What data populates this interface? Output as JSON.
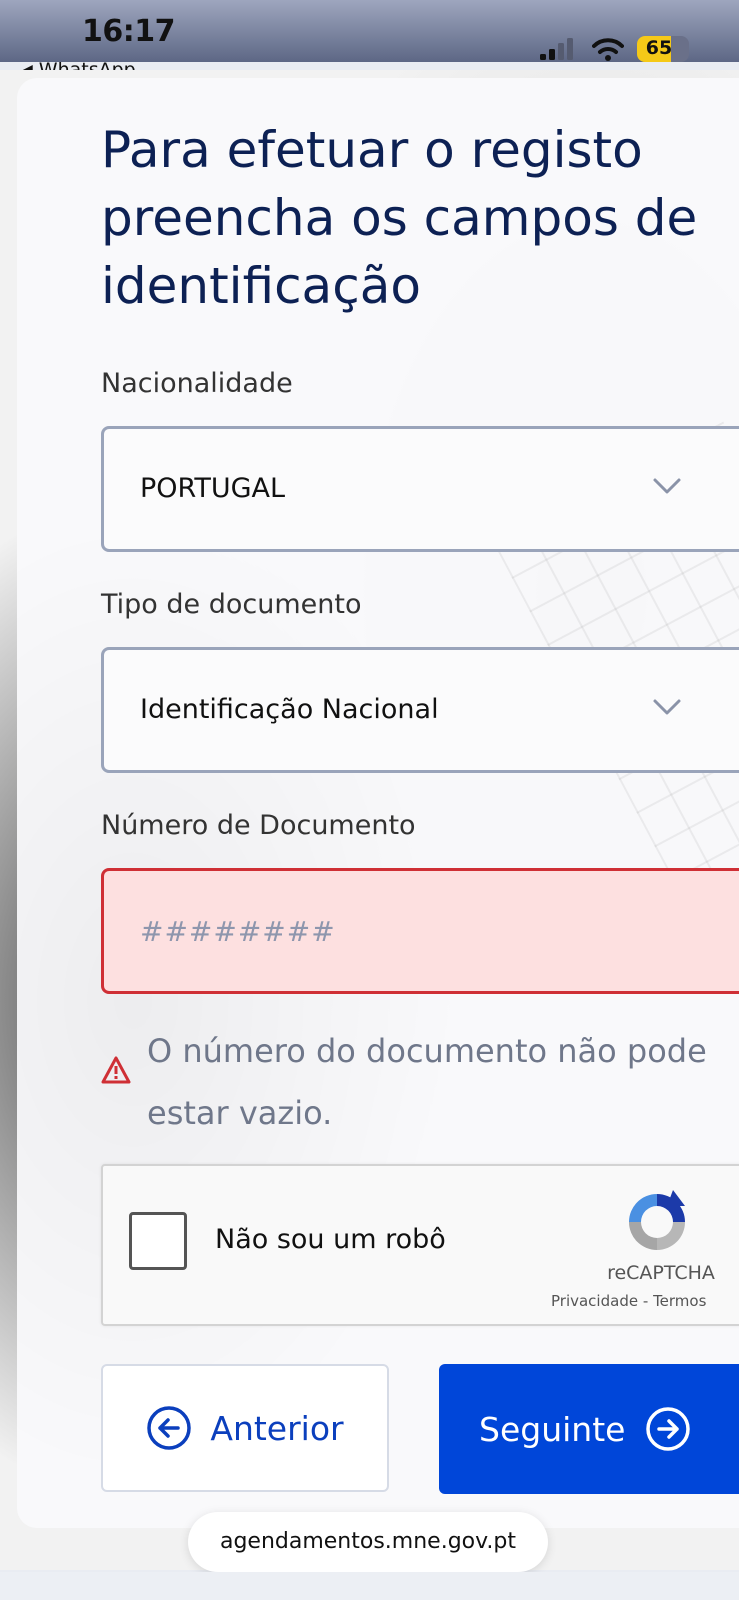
{
  "status_bar": {
    "time": "16:17",
    "back_app": "WhatsApp",
    "battery": "65",
    "battery_level_percent": 65
  },
  "form": {
    "title": "Para efetuar o registo preencha os campos de identificação",
    "nationality": {
      "label": "Nacionalidade",
      "value": "PORTUGAL"
    },
    "document_type": {
      "label": "Tipo de documento",
      "value": "Identificação Nacional"
    },
    "document_number": {
      "label": "Número de Documento",
      "value": "",
      "placeholder": "########",
      "error": "O número do documento não pode estar vazio."
    }
  },
  "captcha": {
    "label": "Não sou um robô",
    "brand": "reCAPTCHA",
    "privacy": "Privacidade",
    "separator": "-",
    "terms": "Termos"
  },
  "buttons": {
    "previous": "Anterior",
    "next": "Seguinte"
  },
  "browser": {
    "url": "agendamentos.mne.gov.pt"
  },
  "colors": {
    "title": "#0d2154",
    "primary": "#0046d9",
    "error_border": "#cf2f35",
    "error_fill": "#fde0e0"
  }
}
